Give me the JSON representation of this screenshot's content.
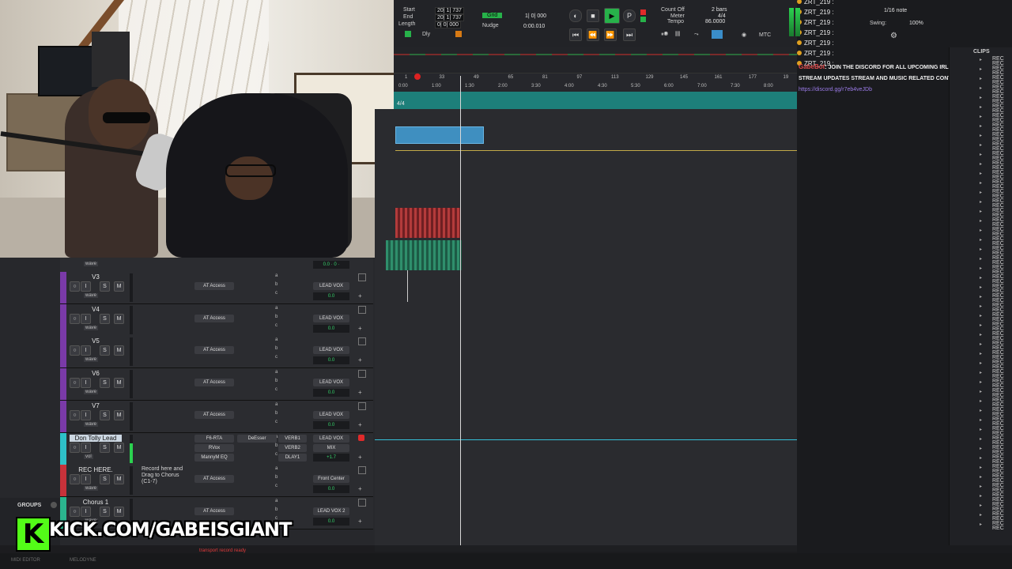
{
  "transport": {
    "start_label": "Start",
    "start_val": "20| 1| 737",
    "end_label": "End",
    "end_val": "20| 1| 737",
    "length_label": "Length",
    "length_val": "0| 0| 000",
    "dly_label": "Dly",
    "grid_label": "Grid",
    "grid_val": "1| 0| 000",
    "nudge_label": "Nudge",
    "nudge_val": "0:00.010",
    "count_off_label": "Count Off",
    "count_off_val": "2 bars",
    "meter_label": "Meter",
    "meter_val": "4/4",
    "tempo_label": "Tempo",
    "tempo_val": "86.0000",
    "mtc_label": "MTC"
  },
  "right_panel": {
    "users": [
      "ZRT_219 :",
      "ZRT_219 :",
      "ZRT_219 :",
      "ZRT_219 :",
      "ZRT_219 :",
      "ZRT_219 :",
      "ZRT_219 :"
    ],
    "note_val": "1/16 note",
    "swing_label": "Swing:",
    "swing_val": "100%",
    "chat_sender": "GabeBot",
    "chat_line1": ": JOIN THE DISCORD FOR ALL UPCOMING IRL & DESKTOP",
    "chat_line2": "STREAM UPDATES STREAM AND MUSIC RELATED CONTENT",
    "chat_link": "https://discord.gg/r7eb4veJDb",
    "clips_label": "CLIPS",
    "clip_item": "REC"
  },
  "ruler": {
    "bars": [
      "1",
      "33",
      "49",
      "65",
      "81",
      "97",
      "113",
      "129",
      "145",
      "161",
      "177",
      "19"
    ],
    "times": [
      "0:00",
      "1:00",
      "1:30",
      "2:00",
      "3:30",
      "4:00",
      "4:30",
      "5:30",
      "6:00",
      "7:00",
      "7:30",
      "8:00",
      "10:00",
      "10:30",
      "11:00",
      "11:30",
      "12:0"
    ],
    "tempo_lane": "4/4"
  },
  "tracks": [
    {
      "name": "V3",
      "color": "#7a3aa8",
      "plugin": "AT Access",
      "bus": "LEAD VOX",
      "vol": "0.0"
    },
    {
      "name": "V4",
      "color": "#7a3aa8",
      "plugin": "AT Access",
      "bus": "LEAD VOX",
      "vol": "0.0"
    },
    {
      "name": "V5",
      "color": "#7a3aa8",
      "plugin": "AT Access",
      "bus": "LEAD VOX",
      "vol": "0.0"
    },
    {
      "name": "V6",
      "color": "#7a3aa8",
      "plugin": "AT Access",
      "bus": "LEAD VOX",
      "vol": "0.0"
    },
    {
      "name": "V7",
      "color": "#7a3aa8",
      "plugin": "AT Access",
      "bus": "LEAD VOX",
      "vol": "0.0"
    },
    {
      "name": "Don Tolly Lead",
      "color": "#2ec0c8",
      "plugin": "F6-RTA",
      "bus": "LEAD VOX",
      "vol": "+1.7"
    },
    {
      "name": "REC HERE.",
      "color": "#c8323a",
      "plugin": "AT Access",
      "bus": "Front Center",
      "vol": "0.0"
    },
    {
      "name": "Chorus 1",
      "color": "#2bb58e",
      "plugin": "AT Access",
      "bus": "LEAD VOX 2",
      "vol": "0.0"
    }
  ],
  "lead_track": {
    "inserts": [
      "F6-RTA",
      "RVox",
      "MannyM EQ"
    ],
    "deesser": "DeEsser",
    "sends": [
      "VERB1",
      "VERB2",
      "DLAY1"
    ],
    "mix": "MIX",
    "pan_l": "P",
    "pan_r": "P"
  },
  "rec_note": "Record here and Drag to Chorus (C1-7)",
  "track_btns": {
    "i": "I",
    "s": "S",
    "m": "M",
    "wave": "wave",
    "vol": "vol"
  },
  "groups_label": "GROUPS",
  "kick": {
    "k": "K",
    "text": "KICK.COM/GABEISGIANT"
  },
  "status": {
    "midi": "MIDI EDITOR",
    "melody": "MELODYNE",
    "msg": "transport record ready"
  },
  "colors": {
    "accent": "#53fc18",
    "tempo_lane": "#1d7f7a",
    "clip_blue": "#3f8fc0"
  }
}
